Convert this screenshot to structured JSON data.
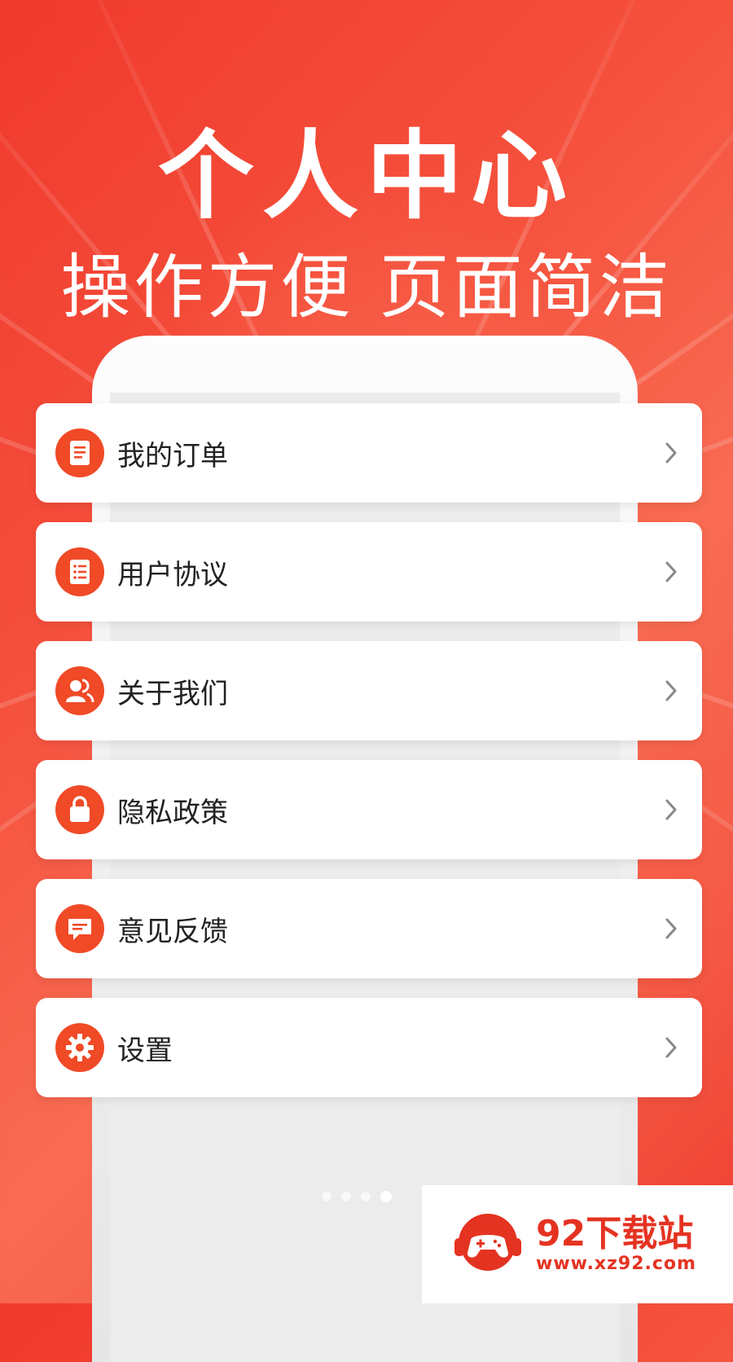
{
  "header": {
    "title": "个人中心",
    "subtitle": "操作方便 页面简洁"
  },
  "menu": {
    "items": [
      {
        "label": "我的订单",
        "icon": "order-list-icon"
      },
      {
        "label": "用户协议",
        "icon": "agreement-list-icon"
      },
      {
        "label": "关于我们",
        "icon": "users-icon"
      },
      {
        "label": "隐私政策",
        "icon": "lock-icon"
      },
      {
        "label": "意见反馈",
        "icon": "feedback-chat-icon"
      },
      {
        "label": "设置",
        "icon": "gear-icon"
      }
    ]
  },
  "carousel": {
    "count": 4,
    "active": 4
  },
  "watermark": {
    "title": "92下载站",
    "url": "www.xz92.com"
  },
  "colors": {
    "accent": "#f04a27",
    "background": "#f5513d"
  }
}
